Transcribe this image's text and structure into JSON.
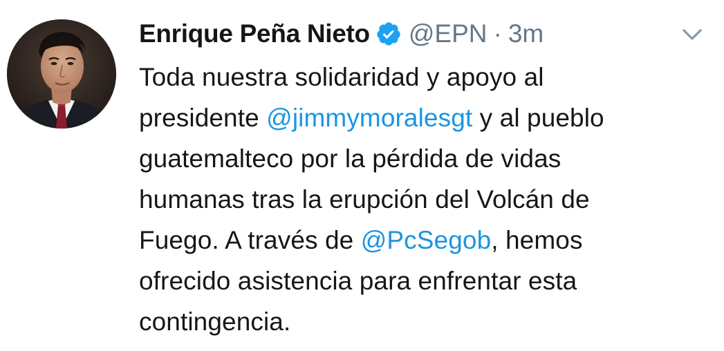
{
  "author": {
    "name": "Enrique Peña Nieto",
    "handle": "@EPN",
    "separator": "·",
    "time": "3m",
    "verified": true
  },
  "icons": {
    "verified": "verified-badge-icon",
    "menu": "chevron-down-icon"
  },
  "colors": {
    "text": "#14171a",
    "secondary": "#657786",
    "link": "#1b95e0",
    "verified": "#1da1f2"
  },
  "tweet": {
    "line1": "Toda nuestra solidaridad y apoyo al",
    "line2_before": "presidente ",
    "mention1": "@jimmymoralesgt",
    "line2_after": " y al pueblo",
    "line3": "guatemalteco por la pérdida de vidas",
    "line4": "humanas tras la erupción del Volcán de",
    "line5_before": "Fuego. A través de ",
    "mention2": "@PcSegob",
    "line5_after": ", hemos",
    "line6": "ofrecido asistencia para enfrentar esta",
    "line7": "contingencia."
  }
}
